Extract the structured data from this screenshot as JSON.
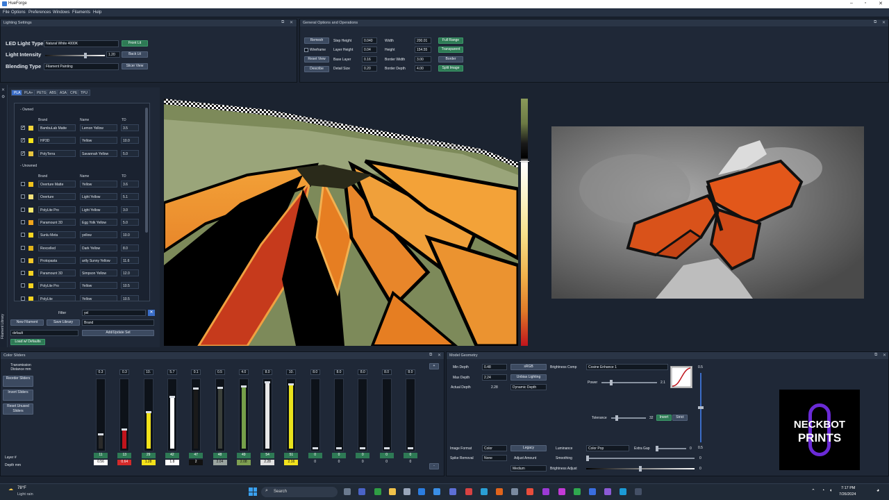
{
  "window": {
    "title": "HueForge"
  },
  "menu": [
    "File",
    "Options",
    "Preferences",
    "Windows",
    "Filaments",
    "Help"
  ],
  "lighting": {
    "title": "Lighting Settings",
    "led_label": "LED Light Type",
    "led_value": "Natural White 4000K",
    "intensity_label": "Light Intensity",
    "intensity_value": "1.20",
    "intensity_fraction": 0.75,
    "blending_label": "Blending Type",
    "blending_value": "Filament Painting",
    "front_lit": "Front Lit",
    "back_lit": "Back Lit",
    "slicer_view": "Slicer View"
  },
  "general": {
    "title": "General Options and Operations",
    "remesh": "Remesh",
    "wireframe": "Wireframe",
    "reset_view": "Reset View",
    "describe": "Describe",
    "step_height_label": "Step Height",
    "step_height": "0.040",
    "layer_height_label": "Layer Height",
    "layer_height": "0.04",
    "base_layer_label": "Base Layer",
    "base_layer": "0.16",
    "detail_size_label": "Detail Size",
    "detail_size": "0.20",
    "width_label": "Width",
    "width": "200.01",
    "height_label": "Height",
    "height": "154.55",
    "border_width_label": "Border Width",
    "border_width": "3.00",
    "border_depth_label": "Border Depth",
    "border_depth": "4.00",
    "full_range": "Full Range",
    "transparent": "Transparent",
    "border": "Border",
    "split_image": "Split Image"
  },
  "filament_library": {
    "side_title": "Filament Library",
    "tabs": [
      "PLA",
      "PLA+",
      "PETG",
      "ABS",
      "ASA",
      "CPE",
      "TPU"
    ],
    "owned_label": "Owned",
    "unowned_label": "Unowned",
    "col_brand": "Brand",
    "col_name": "Name",
    "col_td": "TD",
    "owned": [
      {
        "brand": "BambuLab Matte",
        "name": "Lemon Yellow",
        "td": "3.5",
        "color": "#f2d43a",
        "checked": true
      },
      {
        "brand": "HP3D",
        "name": "Yellow",
        "td": "10.0",
        "color": "#f5e41a",
        "checked": true
      },
      {
        "brand": "PolyTerra",
        "name": "Savannah Yellow",
        "td": "5.0",
        "color": "#e8c53e",
        "checked": true
      }
    ],
    "unowned": [
      {
        "brand": "Overture Matte",
        "name": "Yellow",
        "td": "3.6",
        "color": "#f0c21c"
      },
      {
        "brand": "Overture",
        "name": "Light Yellow",
        "td": "5.1",
        "color": "#f3e17a"
      },
      {
        "brand": "PolyLite Pro",
        "name": "Light Yellow",
        "td": "3.0",
        "color": "#f5e86d"
      },
      {
        "brand": "Paramount 3D",
        "name": "Egg Yolk Yellow",
        "td": "5.0",
        "color": "#f0a51c"
      },
      {
        "brand": "Sunlu Meta",
        "name": "yellow",
        "td": "10.0",
        "color": "#f7d521"
      },
      {
        "brand": "Rexcelled",
        "name": "Dark Yellow",
        "td": "8.0",
        "color": "#e0b21a"
      },
      {
        "brand": "Protopasta",
        "name": "artly Sunny Yellow",
        "td": "11.6",
        "color": "#f3c728"
      },
      {
        "brand": "Paramount 3D",
        "name": "Simpson Yellow",
        "td": "12.0",
        "color": "#f4d222"
      },
      {
        "brand": "PolyLite Pro",
        "name": "Yellow",
        "td": "10.5",
        "color": "#f5d31f"
      },
      {
        "brand": "PolyLite",
        "name": "Yellow",
        "td": "10.5",
        "color": "#f5d31f"
      }
    ],
    "filter_label": "Filter",
    "filter_value": "yel",
    "new_filament": "New Filament",
    "save_library": "Save Library",
    "brand_select": "Brand",
    "library_select": "default",
    "add_update_set": "Add/Update Set",
    "load_defaults": "Load w/ Defaults"
  },
  "color_sliders": {
    "title": "Color Sliders",
    "transmission_label": "Transmission Distance mm",
    "reorder": "Reorder Sliders",
    "invert": "Invert Sliders",
    "reset_unused": "Reset Unused Sliders",
    "layer_label": "Layer #",
    "depth_label": "Depth mm",
    "sliders": [
      {
        "td": "0.3",
        "layer": "11",
        "depth": "0.56",
        "color": "#2a2a2a",
        "level": 0.2,
        "depth_bg": "#ffffff"
      },
      {
        "td": "0.3",
        "layer": "13",
        "depth": "0.64",
        "color": "#c0141c",
        "level": 0.27,
        "depth_bg": "#d42a2a"
      },
      {
        "td": "10.",
        "layer": "29",
        "depth": "1.28",
        "color": "#f1e21a",
        "level": 0.53,
        "depth_bg": "#f4e11a"
      },
      {
        "td": "5.7",
        "layer": "42",
        "depth": "1.8",
        "color": "#ffffff",
        "level": 0.75,
        "depth_bg": "#ffffff"
      },
      {
        "td": "0.1",
        "layer": "47",
        "depth": "2",
        "color": "#1a1a1a",
        "level": 0.87,
        "depth_bg": "#111111"
      },
      {
        "td": "0.5",
        "layer": "48",
        "depth": "2.04",
        "color": "#3a3f3a",
        "level": 0.88,
        "depth_bg": "#9aa4a0"
      },
      {
        "td": "4.0",
        "layer": "49",
        "depth": "2.08",
        "color": "#76a04a",
        "level": 0.9,
        "depth_bg": "#7fa052"
      },
      {
        "td": "8.0",
        "layer": "54",
        "depth": "2.28",
        "color": "#e8e8e8",
        "level": 0.96,
        "depth_bg": "#e2e2e2"
      },
      {
        "td": "10.",
        "layer": "51",
        "depth": "2.16",
        "color": "#e9e21c",
        "level": 0.93,
        "depth_bg": "#f2e21d"
      },
      {
        "td": "8.0",
        "layer": "0",
        "depth": "0",
        "color": "#eeeeee",
        "level": 0,
        "depth_bg": "none"
      },
      {
        "td": "8.0",
        "layer": "0",
        "depth": "0",
        "color": "#eeeeee",
        "level": 0,
        "depth_bg": "none"
      },
      {
        "td": "8.0",
        "layer": "0",
        "depth": "0",
        "color": "#eeeeee",
        "level": 0,
        "depth_bg": "none"
      },
      {
        "td": "8.0",
        "layer": "0",
        "depth": "0",
        "color": "#eeeeee",
        "level": 0,
        "depth_bg": "none"
      },
      {
        "td": "8.0",
        "layer": "0",
        "depth": "0",
        "color": "#eeeeee",
        "level": 0,
        "depth_bg": "none"
      }
    ],
    "plus": "+",
    "minus": "-"
  },
  "model_geometry": {
    "title": "Model Geometry",
    "min_depth_label": "Min Depth",
    "min_depth": "0.48",
    "max_depth_label": "Max Depth",
    "max_depth": "2.24",
    "actual_depth_label": "Actual Depth",
    "actual_depth": "2.28",
    "srgb": "sRGB",
    "unbias_lighting": "Unbias Lighting",
    "dynamic_depth": "Dynamic Depth",
    "brightness_comp_label": "Brightness Comp",
    "brightness_comp": "Cosine Enhance 1",
    "power_label": "Power",
    "power": "2.1",
    "tolerance_label": "Tolerance",
    "tolerance": "32",
    "invert": "Invert",
    "strict": "Strict",
    "curve_top": "0.5",
    "curve_bottom": "0.5",
    "image_format_label": "Image Format",
    "image_format": "Color",
    "legacy": "Legacy",
    "adjust_amount": "Adjust Amount",
    "medium": "Medium",
    "spike_removal_label": "Spike Removal",
    "spike_removal": "None",
    "luminance_label": "Luminance",
    "luminance": "Color Pop",
    "extra_gap_label": "Extra Gap",
    "extra_gap": "0",
    "smoothing_label": "Smoothing",
    "smoothing": "0",
    "brightness_adjust_label": "Brightness Adjust",
    "brightness_adjust": "0"
  },
  "logo": {
    "line1": "NECKBOT",
    "line2": "PRINTS"
  },
  "taskbar": {
    "weather_temp": "78°F",
    "weather_desc": "Light rain",
    "search": "Search",
    "time": "7:17 PM",
    "date": "7/26/2024"
  },
  "colors": {
    "accent_green": "#2e7a55",
    "accent_blue": "#3b6ec8",
    "panel_bg": "#1f2837"
  }
}
